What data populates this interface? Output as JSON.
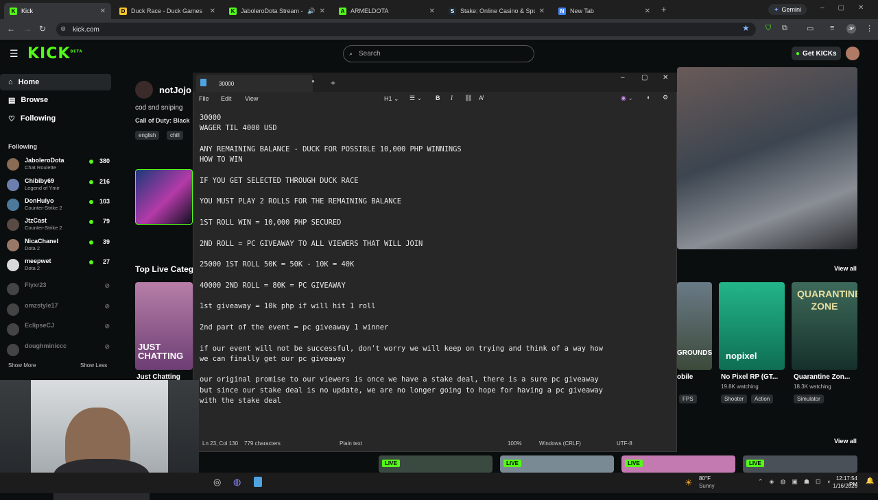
{
  "browser": {
    "tabs": [
      {
        "title": "Kick",
        "icon": "K"
      },
      {
        "title": "Duck Race - Duck Games",
        "icon": "D"
      },
      {
        "title": "JaboleroDota Stream - Wat",
        "icon": "K"
      },
      {
        "title": "ARMELDOTA",
        "icon": "A"
      },
      {
        "title": "Stake: Online Casino & Sports",
        "icon": "S"
      },
      {
        "title": "New Tab",
        "icon": "N"
      }
    ],
    "gemini": "Gemini",
    "url": "kick.com",
    "profile": "JP"
  },
  "kick": {
    "logo": "KICK",
    "logo_badge": "BETA",
    "search_placeholder": "Search",
    "get_kicks": "Get KICKs",
    "nav": {
      "home": "Home",
      "browse": "Browse",
      "following": "Following"
    },
    "following_title": "Following",
    "following": [
      {
        "name": "JaboleroDota",
        "category": "Chat Roulette",
        "viewers": "380",
        "live": true
      },
      {
        "name": "Chibiby69",
        "category": "Legend of Ymir",
        "viewers": "216",
        "live": true
      },
      {
        "name": "DonHulyo",
        "category": "Counter-Strike 2",
        "viewers": "103",
        "live": true
      },
      {
        "name": "JtzCast",
        "category": "Counter-Strike 2",
        "viewers": "79",
        "live": true
      },
      {
        "name": "NicaChanel",
        "category": "Dota 2",
        "viewers": "39",
        "live": true
      },
      {
        "name": "meepwet",
        "category": "Dota 2",
        "viewers": "27",
        "live": true
      },
      {
        "name": "Flyxr23",
        "category": "",
        "viewers": "",
        "live": false
      },
      {
        "name": "omzstyle17",
        "category": "",
        "viewers": "",
        "live": false
      },
      {
        "name": "EclipseCJ",
        "category": "",
        "viewers": "",
        "live": false
      },
      {
        "name": "doughminiccc",
        "category": "",
        "viewers": "",
        "live": false
      }
    ],
    "show_more": "Show More",
    "show_less": "Show Less",
    "featured": {
      "name": "notJojo",
      "title": "cod snd sniping",
      "category": "Call of Duty: Black",
      "tags": [
        "english",
        "chill"
      ]
    },
    "top_live": "Top Live Categ",
    "view_all": "View all",
    "categories": [
      {
        "name": "Just Chatting",
        "cover_text": "JUST CHATTING"
      },
      {
        "name": "obile",
        "watching": "",
        "tags": [
          "FPS"
        ],
        "cover_text": "GROUNDS"
      },
      {
        "name": "No Pixel RP (GT...",
        "watching": "19.8K watching",
        "tags": [
          "Shooter",
          "Action"
        ],
        "cover_text": "nopixel"
      },
      {
        "name": "Quarantine Zon...",
        "watching": "18.3K watching",
        "tags": [
          "Simulator"
        ],
        "cover_text": "QUARANTINE ZONE"
      }
    ],
    "live_badge": "LIVE"
  },
  "notepad": {
    "title": "30000",
    "menu": [
      "File",
      "Edit",
      "View"
    ],
    "heading": "H1",
    "lines": [
      "30000",
      "WAGER TIL 4000 USD",
      "",
      "ANY REMAINING BALANCE - DUCK FOR POSSIBLE 10,000 PHP WINNINGS",
      "HOW TO WIN",
      "",
      "IF YOU GET SELECTED THROUGH DUCK RACE",
      "",
      "YOU MUST PLAY 2 ROLLS FOR THE REMAINING BALANCE",
      "",
      "1ST ROLL WIN = 10,000 PHP SECURED",
      "",
      "2ND ROLL = PC GIVEAWAY TO ALL VIEWERS THAT WILL JOIN",
      "",
      "25000 1ST ROLL 50K = 50K - 10K = 40K",
      "",
      "40000 2ND ROLL = 80K = PC GIVEAWAY",
      "",
      "1st giveaway = 10k php if will hit 1 roll",
      "",
      "2nd part of the event = pc giveaway 1 winner",
      "",
      "if our event will not be successful, don't worry we will keep on trying and think of a way how",
      "we can finally get our pc giveaway",
      "",
      "our original promise to our viewers is once we have a stake deal, there is a sure pc giveaway",
      "but since our stake deal is no update, we are no longer going to hope for having a pc giveaway",
      "with the stake deal"
    ],
    "status": {
      "position": "Ln 23, Col 130",
      "chars": "779 characters",
      "format": "Plain text",
      "zoom": "100%",
      "eol": "Windows (CRLF)",
      "encoding": "UTF-8"
    }
  },
  "taskbar": {
    "weather_temp": "80°F",
    "weather_desc": "Sunny",
    "time": "12:17:54 PM",
    "date": "1/16/2026"
  }
}
